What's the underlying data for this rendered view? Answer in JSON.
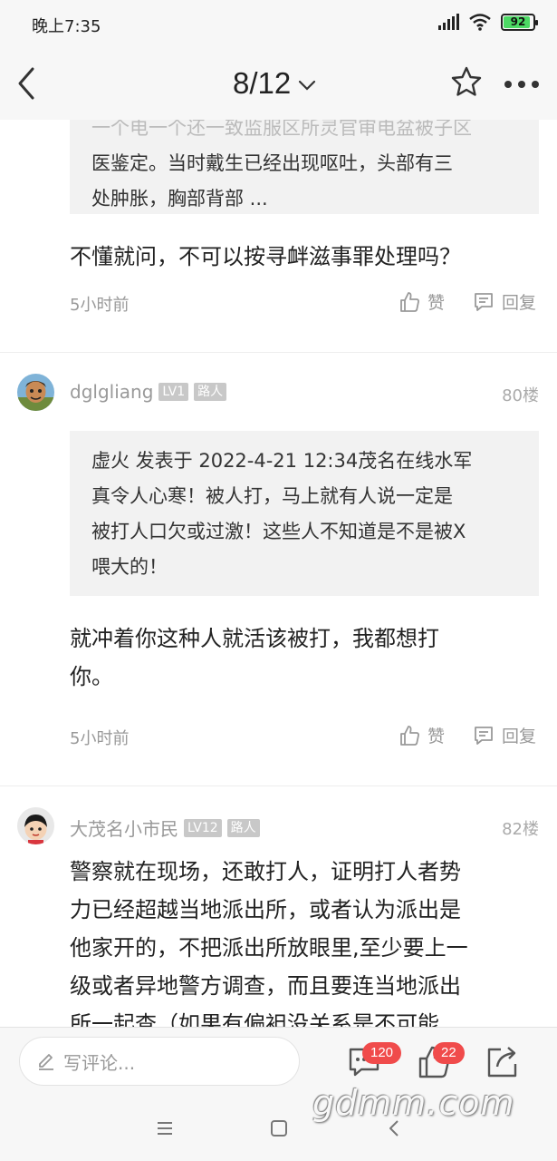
{
  "status_bar": {
    "time": "晚上7:35",
    "battery": "92",
    "battery_level": 0.92
  },
  "header": {
    "page_indicator": "8/12"
  },
  "posts": [
    {
      "quote_lines": [
        "一个电一个还一致监服区所灵官审电盆被子区",
        "医鉴定。当时戴生已经出现呕吐，头部有三",
        "处肿胀，胸部背部 ..."
      ],
      "body_lines": [
        "不懂就问，不可以按寻衅滋事罪处理吗？"
      ],
      "time": "5小时前",
      "like_label": "赞",
      "reply_label": "回复"
    },
    {
      "username": "dglgliang",
      "level": "LV1",
      "tag": "路人",
      "floor": "80楼",
      "quote_lines": [
        "虚火 发表于 2022-4-21 12:34茂名在线水军",
        "真令人心寒！被人打，马上就有人说一定是",
        "被打人口欠或过激！这些人不知道是不是被X",
        "喂大的！"
      ],
      "body_lines": [
        "就冲着你这种人就活该被打，我都想打",
        "你。"
      ],
      "time": "5小时前",
      "like_label": "赞",
      "reply_label": "回复"
    },
    {
      "username": "大茂名小市民",
      "level": "LV12",
      "tag": "路人",
      "floor": "82楼",
      "body_lines": [
        "警察就在现场，还敢打人，证明打人者势",
        "力已经超越当地派出所，或者认为派出是",
        "他家开的，不把派出所放眼里,至少要上一",
        "级或者异地警方调查，而且要连当地派出",
        "所一起查（如果有偏袒没关系是不可能"
      ]
    }
  ],
  "bottom_bar": {
    "comment_placeholder": "写评论...",
    "comment_count": "120",
    "like_count": "22"
  },
  "watermark": "gdmm.com"
}
